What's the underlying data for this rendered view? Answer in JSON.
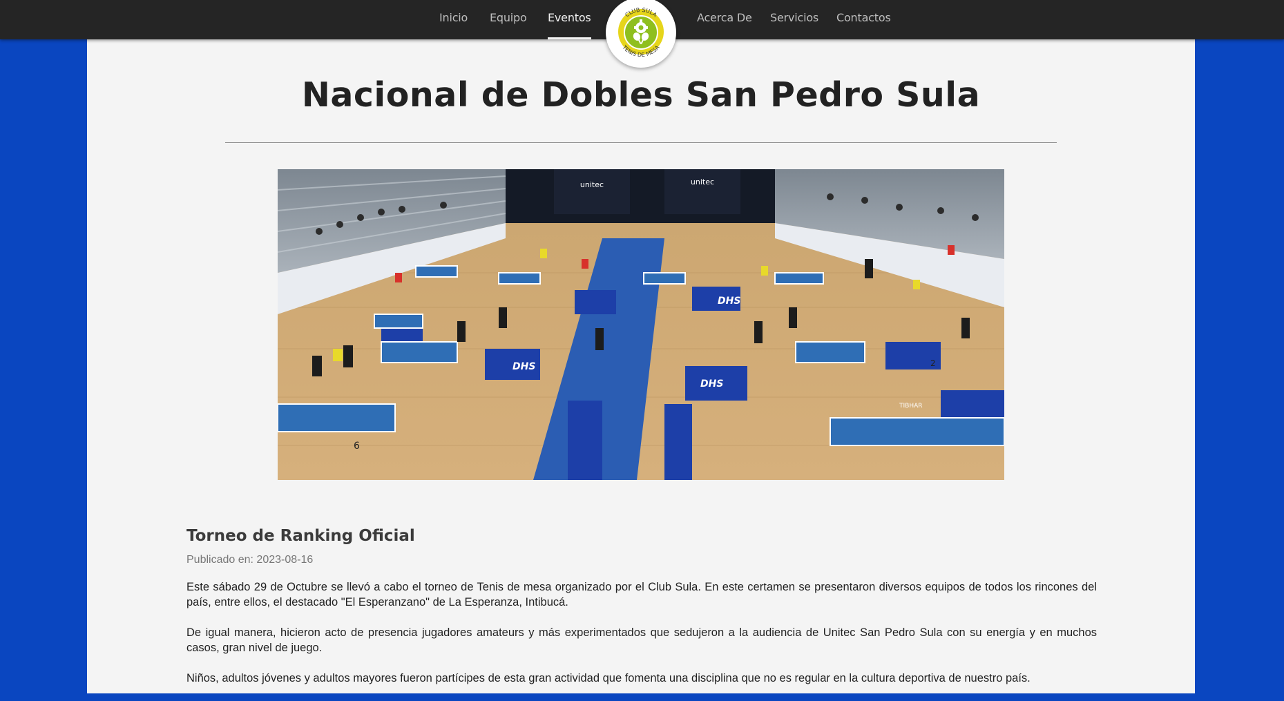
{
  "nav": {
    "left_items": [
      {
        "label": "Inicio"
      },
      {
        "label": "Equipo"
      },
      {
        "label": "Eventos",
        "active": true
      }
    ],
    "right_items": [
      {
        "label": "Acerca De"
      },
      {
        "label": "Servicios"
      },
      {
        "label": "Contactos"
      }
    ]
  },
  "logo": {
    "top_text": "CLUB SULA",
    "bottom_text": "TENIS DE MESA",
    "colors": {
      "outer": "#e9d91e",
      "inner": "#93c21c",
      "ring": "#ffffff"
    }
  },
  "event": {
    "title": "Nacional de Dobles San Pedro Sula"
  },
  "hero_image": {
    "sponsor_banner": "unitec",
    "table_brand": "TIBHAR",
    "barrier_brand": "DHS",
    "table_numbers": [
      "6",
      "2"
    ]
  },
  "post": {
    "heading": "Torneo de Ranking Oficial",
    "date_label": "Publicado en:",
    "date": "2023-08-16",
    "paragraphs": [
      "Este sábado 29 de Octubre se llevó a cabo el torneo de Tenis de mesa organizado por el Club Sula. En este certamen se presentaron diversos equipos de todos los rincones del país, entre ellos, el destacado \"El Esperanzano\" de La Esperanza, Intibucá.",
      "De igual manera, hicieron acto de presencia jugadores amateurs y más experimentados que sedujeron a la audiencia de Unitec San Pedro Sula con su energía y en muchos casos, gran nivel de juego.",
      "Niños, adultos jóvenes y adultos mayores fueron partícipes de esta gran actividad que fomenta una disciplina que no es regular en la cultura deportiva de nuestro país."
    ]
  },
  "colors": {
    "background_blue": "#0a46c0",
    "navbar": "#252525",
    "page": "#f4f4f4"
  }
}
